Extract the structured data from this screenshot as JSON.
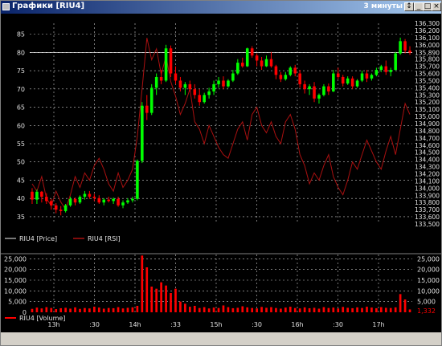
{
  "window": {
    "title": "Графики [RIU4]",
    "period_label": "3 минуты",
    "buttons": [
      "pin-icon",
      "minimize-icon",
      "maximize-icon",
      "close-icon"
    ]
  },
  "colors": {
    "background": "#000000",
    "grid": "#c8c8c8",
    "bull_candle": "#00ff00",
    "bear_candle": "#ff0000",
    "rsi_line": "#aa1010",
    "volume": "#ff0000",
    "text": "#e0e0e0"
  },
  "price_panel": {
    "legend": [
      {
        "label": "RIU4 [Price]",
        "swatch": "#a0a0a0"
      },
      {
        "label": "RIU4 [RSI]",
        "swatch": "#aa1010"
      }
    ],
    "left_axis_ticks": [
      "85",
      "80",
      "75",
      "70",
      "65",
      "60",
      "55",
      "50",
      "45",
      "40",
      "35"
    ],
    "right_axis_ticks": [
      "136,300",
      "136,200",
      "136,100",
      "136,000",
      "135,890",
      "135,800",
      "135,700",
      "135,600",
      "135,500",
      "135,400",
      "135,300",
      "135,200",
      "135,100",
      "135,000",
      "134,900",
      "134,800",
      "134,700",
      "134,600",
      "134,500",
      "134,400",
      "134,300",
      "134,200",
      "134,100",
      "134,000",
      "133,900",
      "133,800",
      "133,700",
      "133,600",
      "133,500"
    ],
    "last_price_label": "135,890"
  },
  "volume_panel": {
    "legend": [
      {
        "label": "RIU4 [Volume]",
        "swatch": "#ff0000"
      }
    ],
    "left_axis_ticks": [
      "25,000",
      "20,000",
      "15,000",
      "10,000",
      "5,000",
      "0"
    ],
    "right_axis_ticks": [
      "25,000",
      "20,000",
      "15,000",
      "10,000",
      "5,000"
    ],
    "last_volume_label": "1,332"
  },
  "time_axis": {
    "labels": [
      "13h",
      ":30",
      "14h",
      ":33",
      "15h",
      ":30",
      "16h",
      ":30",
      "17h"
    ]
  },
  "chart_data": [
    {
      "type": "candlestick",
      "title": "",
      "series_name": "RIU4 [Price]",
      "ylabel": "",
      "ylim": [
        133500,
        136300
      ],
      "x": [
        0,
        1,
        2,
        3,
        4,
        5,
        6,
        7,
        8,
        9,
        10,
        11,
        12,
        13,
        14,
        15,
        16,
        17,
        18,
        19,
        20,
        21,
        22,
        23,
        24,
        25,
        26,
        27,
        28,
        29,
        30,
        31,
        32,
        33,
        34,
        35,
        36,
        37,
        38,
        39,
        40,
        41,
        42,
        43,
        44,
        45,
        46,
        47,
        48,
        49,
        50,
        51,
        52,
        53,
        54,
        55,
        56,
        57,
        58,
        59,
        60,
        61,
        62,
        63,
        64,
        65,
        66,
        67,
        68,
        69,
        70,
        71,
        72,
        73,
        74,
        75,
        76,
        77,
        78,
        79
      ],
      "candles": [
        [
          133950,
          134000,
          133780,
          133840
        ],
        [
          133840,
          133980,
          133780,
          133950
        ],
        [
          133950,
          133960,
          133800,
          133880
        ],
        [
          133880,
          133930,
          133780,
          133820
        ],
        [
          133820,
          133850,
          133700,
          133760
        ],
        [
          133760,
          133790,
          133650,
          133700
        ],
        [
          133700,
          133750,
          133620,
          133680
        ],
        [
          133680,
          133780,
          133660,
          133760
        ],
        [
          133760,
          133880,
          133740,
          133850
        ],
        [
          133850,
          133870,
          133760,
          133800
        ],
        [
          133800,
          133900,
          133780,
          133880
        ],
        [
          133880,
          133960,
          133840,
          133920
        ],
        [
          133920,
          133960,
          133850,
          133880
        ],
        [
          133880,
          133920,
          133820,
          133860
        ],
        [
          133860,
          133900,
          133780,
          133800
        ],
        [
          133800,
          133860,
          133760,
          133840
        ],
        [
          133840,
          133880,
          133800,
          133820
        ],
        [
          133820,
          133870,
          133780,
          133850
        ],
        [
          133850,
          133880,
          133740,
          133760
        ],
        [
          133760,
          133830,
          133720,
          133800
        ],
        [
          133800,
          133860,
          133780,
          133830
        ],
        [
          133830,
          133880,
          133800,
          133850
        ],
        [
          133850,
          134400,
          133830,
          134380
        ],
        [
          134380,
          135200,
          134350,
          135150
        ],
        [
          135150,
          135300,
          134950,
          135050
        ],
        [
          135050,
          135450,
          135020,
          135400
        ],
        [
          135400,
          135600,
          135300,
          135550
        ],
        [
          135550,
          135650,
          135450,
          135500
        ],
        [
          135500,
          136000,
          135480,
          135950
        ],
        [
          135950,
          135990,
          135550,
          135600
        ],
        [
          135600,
          135700,
          135450,
          135500
        ],
        [
          135500,
          135550,
          135350,
          135400
        ],
        [
          135400,
          135480,
          135300,
          135450
        ],
        [
          135450,
          135500,
          135350,
          135380
        ],
        [
          135380,
          135450,
          135250,
          135300
        ],
        [
          135300,
          135380,
          135150,
          135200
        ],
        [
          135200,
          135330,
          135180,
          135300
        ],
        [
          135300,
          135400,
          135250,
          135350
        ],
        [
          135350,
          135500,
          135300,
          135450
        ],
        [
          135450,
          135550,
          135400,
          135500
        ],
        [
          135500,
          135560,
          135380,
          135420
        ],
        [
          135420,
          135520,
          135400,
          135500
        ],
        [
          135500,
          135650,
          135480,
          135600
        ],
        [
          135600,
          135800,
          135580,
          135750
        ],
        [
          135750,
          135820,
          135680,
          135700
        ],
        [
          135700,
          135960,
          135690,
          135950
        ],
        [
          135950,
          135980,
          135820,
          135850
        ],
        [
          135850,
          135880,
          135700,
          135780
        ],
        [
          135780,
          135830,
          135650,
          135700
        ],
        [
          135700,
          135850,
          135690,
          135800
        ],
        [
          135800,
          135900,
          135680,
          135700
        ],
        [
          135700,
          135720,
          135520,
          135580
        ],
        [
          135580,
          135620,
          135480,
          135520
        ],
        [
          135520,
          135620,
          135500,
          135580
        ],
        [
          135580,
          135700,
          135560,
          135680
        ],
        [
          135680,
          135720,
          135560,
          135600
        ],
        [
          135600,
          135650,
          135400,
          135450
        ],
        [
          135450,
          135500,
          135320,
          135380
        ],
        [
          135380,
          135450,
          135300,
          135420
        ],
        [
          135420,
          135480,
          135200,
          135250
        ],
        [
          135250,
          135320,
          135180,
          135300
        ],
        [
          135300,
          135450,
          135280,
          135420
        ],
        [
          135420,
          135460,
          135300,
          135350
        ],
        [
          135350,
          135650,
          135340,
          135600
        ],
        [
          135600,
          135680,
          135520,
          135550
        ],
        [
          135550,
          135580,
          135420,
          135460
        ],
        [
          135460,
          135560,
          135440,
          135530
        ],
        [
          135530,
          135560,
          135380,
          135420
        ],
        [
          135420,
          135520,
          135400,
          135500
        ],
        [
          135500,
          135640,
          135480,
          135600
        ],
        [
          135600,
          135650,
          135480,
          135530
        ],
        [
          135530,
          135600,
          135500,
          135580
        ],
        [
          135580,
          135680,
          135560,
          135650
        ],
        [
          135650,
          135720,
          135620,
          135700
        ],
        [
          135700,
          135780,
          135580,
          135620
        ],
        [
          135620,
          135680,
          135560,
          135650
        ],
        [
          135650,
          135900,
          135640,
          135880
        ],
        [
          135880,
          136100,
          135860,
          136050
        ],
        [
          136050,
          136080,
          135880,
          135920
        ],
        [
          135920,
          135980,
          135860,
          135890
        ]
      ]
    },
    {
      "type": "line",
      "series_name": "RIU4 [RSI]",
      "ylim": [
        33,
        88
      ],
      "values": [
        44,
        42,
        46,
        40,
        38,
        42,
        39,
        37,
        41,
        46,
        43,
        47,
        45,
        49,
        51,
        48,
        44,
        42,
        47,
        43,
        45,
        48,
        57,
        70,
        84,
        78,
        81,
        74,
        79,
        72,
        68,
        63,
        66,
        70,
        61,
        59,
        55,
        60,
        57,
        54,
        52,
        51,
        55,
        59,
        61,
        56,
        63,
        65,
        60,
        58,
        61,
        57,
        55,
        61,
        63,
        59,
        52,
        49,
        44,
        47,
        45,
        49,
        52,
        46,
        43,
        41,
        45,
        50,
        48,
        52,
        56,
        53,
        50,
        48,
        53,
        57,
        52,
        59,
        66,
        63
      ]
    },
    {
      "type": "bar",
      "series_name": "RIU4 [Volume]",
      "ylim": [
        0,
        27000
      ],
      "values": [
        1600,
        2200,
        1800,
        2400,
        2000,
        1500,
        1900,
        2100,
        1700,
        2300,
        1600,
        2000,
        1800,
        2600,
        2200,
        1700,
        2000,
        1900,
        2400,
        1800,
        2100,
        2300,
        3000,
        26500,
        21000,
        12000,
        11000,
        14000,
        12500,
        9000,
        11000,
        5000,
        4000,
        2600,
        3000,
        2000,
        2400,
        1800,
        2200,
        2000,
        3200,
        2400,
        1900,
        2100,
        2800,
        2300,
        2000,
        1800,
        2500,
        2100,
        2400,
        2000,
        1700,
        2200,
        2600,
        2000,
        1800,
        2300,
        1900,
        2100,
        1700,
        2400,
        2000,
        2200,
        1800,
        2500,
        2100,
        1900,
        2300,
        2000,
        2600,
        2200,
        1900,
        2400,
        2100,
        2000,
        2300,
        8500,
        6000,
        1332
      ]
    }
  ]
}
